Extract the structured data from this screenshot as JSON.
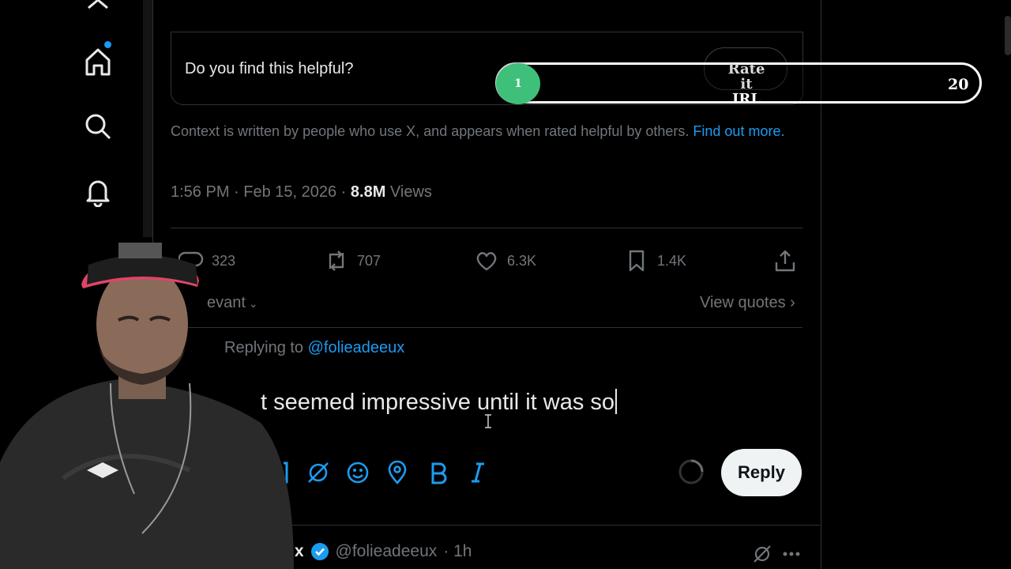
{
  "note": {
    "question": "Do you find this helpful?",
    "context_text": "Context is written by people who use X, and appears when rated helpful by others. ",
    "context_link": "Find out more."
  },
  "post": {
    "time": "1:56 PM · Feb 15, 2026 · ",
    "views_count": "8.8M",
    "views_label": " Views",
    "actions": {
      "replies": "323",
      "reposts": "707",
      "likes": "6.3K",
      "bookmarks": "1.4K"
    }
  },
  "sort": {
    "label": "evant",
    "view_quotes": "View quotes"
  },
  "composer": {
    "replying_prefix": "Replying to ",
    "replying_handle": "@folieadeeux",
    "draft_text": "t seemed impressive until it was so",
    "reply_button": "Reply",
    "tools": [
      "image-icon",
      "gif-icon",
      "grok-icon",
      "emoji-icon",
      "location-icon",
      "bold-icon",
      "italic-icon"
    ]
  },
  "next_post": {
    "name_fragment": "ux",
    "handle": "@folieadeeux",
    "time": "· 1h"
  },
  "overlay": {
    "rate_line1": "Rate it",
    "rate_line2": "IRL",
    "slider_value": "1",
    "slider_max": "20",
    "slider_fraction": 0.0
  },
  "colors": {
    "accent": "#1d9bf0",
    "muted": "#71767b",
    "knob": "#3ec07a"
  }
}
